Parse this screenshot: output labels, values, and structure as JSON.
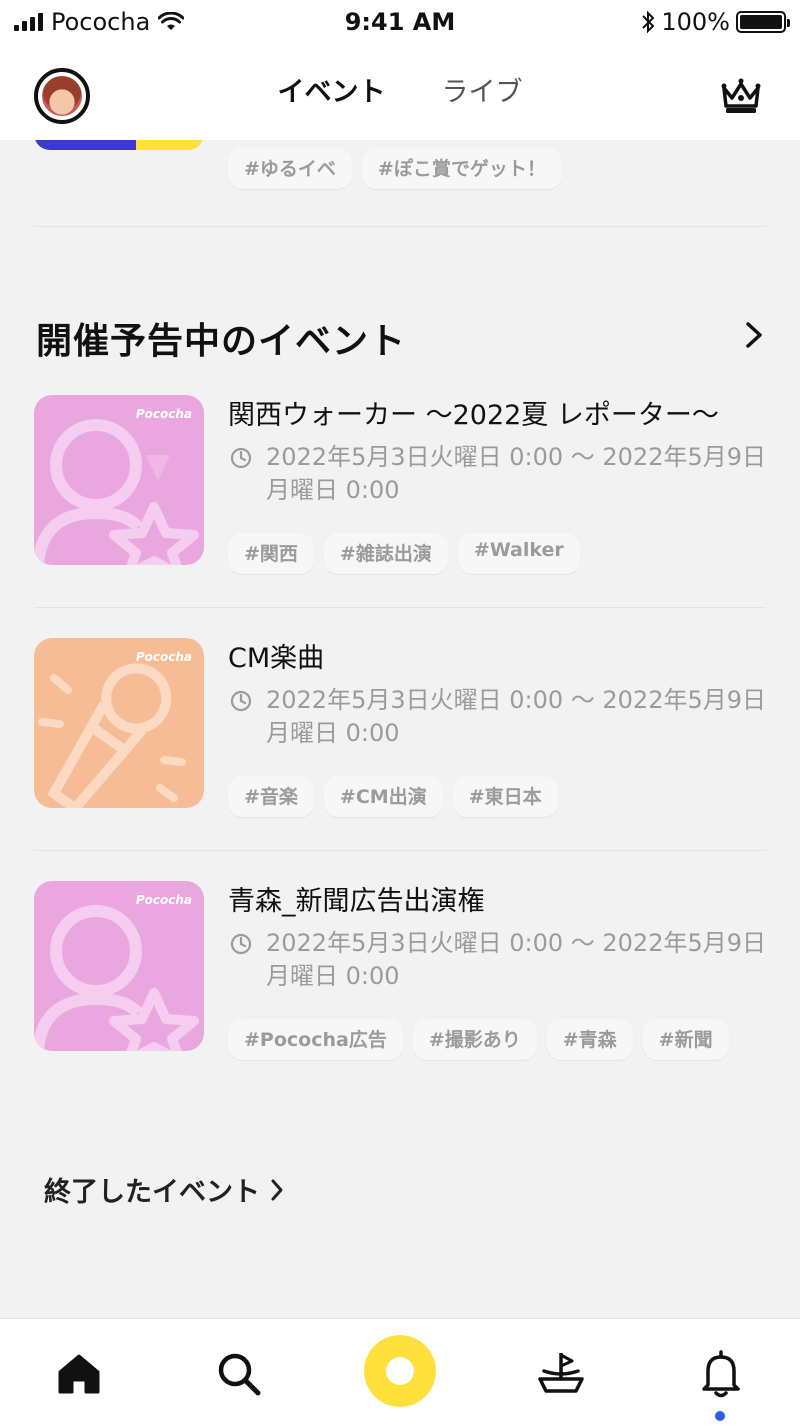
{
  "status_bar": {
    "carrier": "Pococha",
    "time": "9:41 AM",
    "battery": "100%"
  },
  "header": {
    "tabs": [
      {
        "label": "イベント",
        "active": true
      },
      {
        "label": "ライブ",
        "active": false
      }
    ],
    "icons": {
      "avatar": "user-avatar",
      "crown": "crown-icon"
    }
  },
  "previous_event": {
    "tags": [
      "#ゆるイベ",
      "#ぽこ賞でゲット！"
    ]
  },
  "upcoming": {
    "title": "開催予告中のイベント",
    "events": [
      {
        "title": "関西ウォーカー 〜2022夏 レポーター〜",
        "period": "2022年5月3日火曜日 0:00 〜 2022年5月9日月曜日 0:00",
        "tags": [
          "#関西",
          "#雑誌出演",
          "#Walker"
        ],
        "thumb": {
          "brand": "Pococha",
          "color": "#eaa7df",
          "icon": "person-star-icon"
        }
      },
      {
        "title": "CM楽曲",
        "period": "2022年5月3日火曜日 0:00 〜 2022年5月9日月曜日 0:00",
        "tags": [
          "#音楽",
          "#CM出演",
          "#東日本"
        ],
        "thumb": {
          "brand": "Pococha",
          "color": "#f5bc96",
          "icon": "microphone-icon"
        }
      },
      {
        "title": "青森_新聞広告出演権",
        "period": "2022年5月3日火曜日 0:00 〜 2022年5月9日月曜日 0:00",
        "tags": [
          "#Pococha広告",
          "#撮影あり",
          "#青森",
          "#新聞"
        ],
        "thumb": {
          "brand": "Pococha",
          "color": "#eaa7df",
          "icon": "person-star-icon"
        }
      }
    ]
  },
  "ended_link": "終了したイベント",
  "bottom_nav": {
    "items": [
      "home-icon",
      "search-icon",
      "live-button",
      "ship-icon",
      "bell-icon"
    ],
    "accent": "#ffe03d",
    "notification_dot": "#2f5bea"
  }
}
